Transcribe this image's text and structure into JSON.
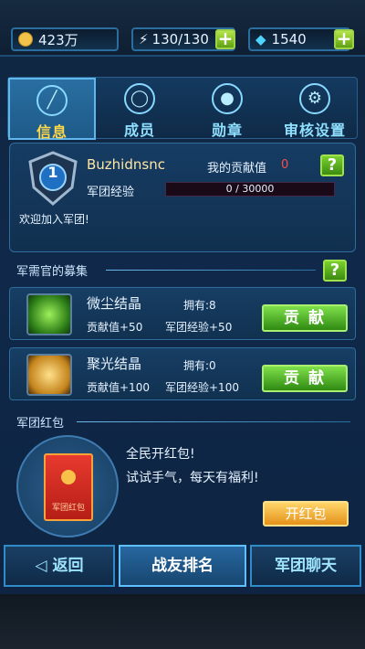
{
  "resources": {
    "gold": "423万",
    "energy": "130/130",
    "diamond": "1540"
  },
  "tabs": [
    {
      "label": "信息",
      "icon": "chart-icon",
      "active": true
    },
    {
      "label": "成员",
      "icon": "member-icon",
      "active": false
    },
    {
      "label": "勋章",
      "icon": "medal-icon",
      "active": false
    },
    {
      "label": "审核设置",
      "icon": "gear-icon",
      "active": false
    }
  ],
  "info": {
    "level": "1",
    "name": "Buzhidnsnc",
    "contribution_label": "我的贡献值",
    "contribution_value": "0",
    "exp_label": "军团经验",
    "exp_value": "0 / 30000",
    "welcome": "欢迎加入军团!"
  },
  "recruit": {
    "title": "军需官的募集",
    "items": [
      {
        "name": "微尘结晶",
        "owned": "拥有:8",
        "contribution": "贡献值+50",
        "exp": "军团经验+50",
        "button": "贡 献",
        "icon": "green-crystal-icon"
      },
      {
        "name": "聚光结晶",
        "owned": "拥有:0",
        "contribution": "贡献值+100",
        "exp": "军团经验+100",
        "button": "贡 献",
        "icon": "gold-crystal-icon"
      }
    ]
  },
  "red_packet": {
    "title": "军团红包",
    "packet_label": "军团红包",
    "line1": "全民开红包!",
    "line2": "试试手气，每天有福利!",
    "button": "开红包"
  },
  "bottom_nav": {
    "back": "返回",
    "ranking": "战友排名",
    "chat": "军团聊天"
  },
  "colors": {
    "accent": "#5fb7ee",
    "button_green": "#4fb822",
    "button_orange": "#f2ad3a",
    "contribution_value": "#ff4b4b"
  }
}
